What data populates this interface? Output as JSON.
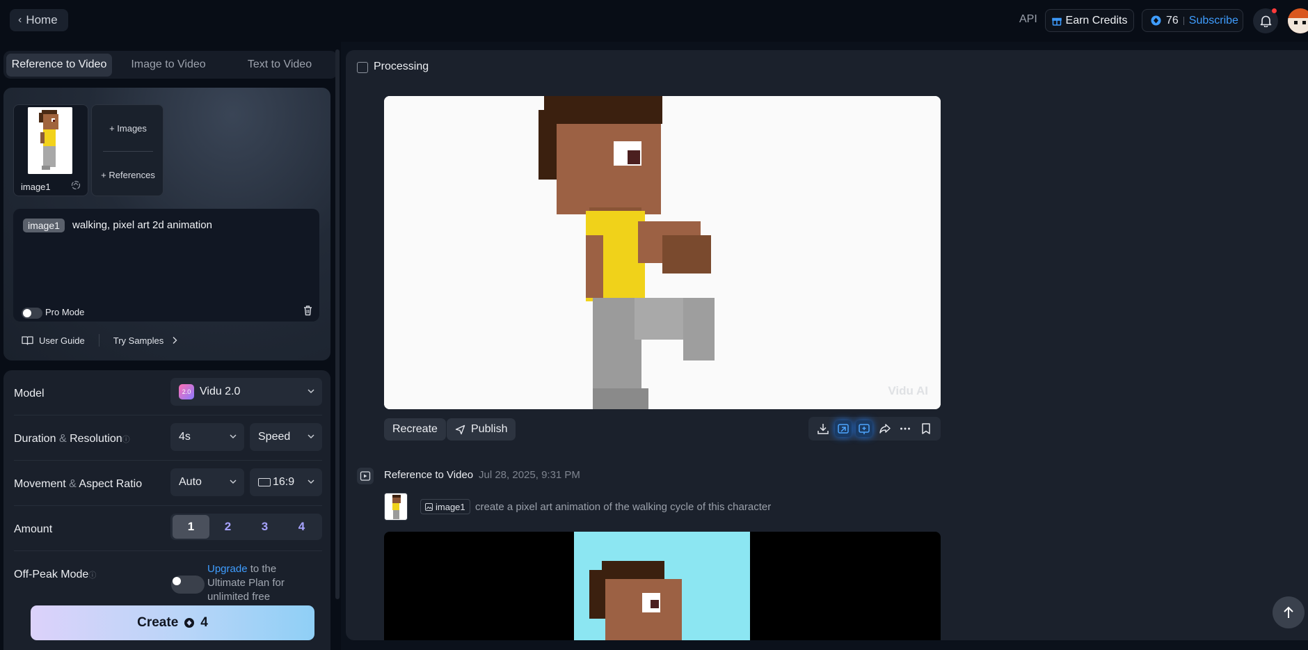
{
  "topbar": {
    "home_label": "Home",
    "api_label": "API",
    "earn_label": "Earn Credits",
    "credits": "76",
    "subscribe_label": "Subscribe"
  },
  "tabs": [
    {
      "label": "Reference to Video",
      "active": true
    },
    {
      "label": "Image to Video",
      "active": false
    },
    {
      "label": "Text to Video",
      "active": false
    }
  ],
  "reference": {
    "image_label": "image1",
    "add_images": "+ Images",
    "add_references": "+ References"
  },
  "prompt": {
    "tag": "image1",
    "text": "walking, pixel art 2d animation",
    "pro_mode_label": "Pro Mode"
  },
  "links": {
    "user_guide": "User Guide",
    "try_samples": "Try Samples"
  },
  "settings": {
    "model_label": "Model",
    "model_value": "Vidu 2.0",
    "duration_label_a": "Duration",
    "duration_label_b": "Resolution",
    "duration_value": "4s",
    "resolution_value": "Speed",
    "movement_label_a": "Movement",
    "movement_label_b": "Aspect Ratio",
    "movement_value": "Auto",
    "aspect_value": "16:9",
    "amount_label": "Amount",
    "amount_options": [
      "1",
      "2",
      "3",
      "4"
    ],
    "amount_selected": "1",
    "offpeak_label": "Off-Peak Mode",
    "upgrade_link": "Upgrade",
    "upgrade_rest": " to the Ultimate Plan for unlimited free"
  },
  "create": {
    "label": "Create",
    "cost": "4"
  },
  "main": {
    "processing_label": "Processing",
    "watermark": "Vidu AI",
    "recreate_label": "Recreate",
    "publish_label": "Publish",
    "task_title": "Reference to Video",
    "task_date": "Jul 28, 2025, 9:31 PM",
    "task_tag": "image1",
    "task_prompt": "create a pixel art animation of the walking cycle of this character"
  }
}
